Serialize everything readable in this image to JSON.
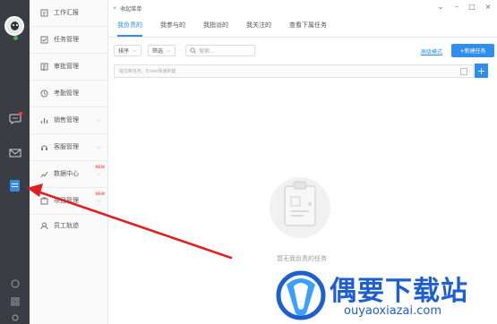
{
  "window": {
    "title": "收起菜单",
    "controls": [
      "⌄",
      "–",
      "□",
      "×"
    ]
  },
  "rail": {
    "icons": [
      "avatar",
      "chat-icon",
      "mail-icon",
      "task-icon",
      "bottom-icon-1",
      "bottom-icon-2",
      "bottom-icon-3"
    ]
  },
  "menu": {
    "items": [
      {
        "label": "工作汇报",
        "icon": "report-icon",
        "has_chevron": false
      },
      {
        "label": "任务管理",
        "icon": "task-check-icon",
        "has_chevron": false
      },
      {
        "label": "审批管理",
        "icon": "approval-icon",
        "has_chevron": false
      },
      {
        "label": "考勤管理",
        "icon": "attendance-icon",
        "has_chevron": false
      },
      {
        "label": "销售管理",
        "icon": "sales-icon",
        "has_chevron": true
      },
      {
        "label": "客服管理",
        "icon": "service-icon",
        "has_chevron": true
      },
      {
        "label": "数据中心",
        "icon": "data-icon",
        "has_chevron": true,
        "badge": "NEW"
      },
      {
        "label": "项目管理",
        "icon": "project-icon",
        "has_chevron": true,
        "badge": "NEW"
      },
      {
        "label": "员工轨迹",
        "icon": "track-icon",
        "has_chevron": false
      }
    ]
  },
  "tabs": [
    {
      "label": "我负责的",
      "active": true
    },
    {
      "label": "我参与的",
      "active": false
    },
    {
      "label": "我指派的",
      "active": false
    },
    {
      "label": "我关注的",
      "active": false
    },
    {
      "label": "查看下属任务",
      "active": false
    }
  ],
  "toolbar": {
    "sort_label": "排序",
    "filter_label": "筛选",
    "search_placeholder": "搜索...",
    "advanced_label": "高级模式",
    "new_task_label": "+新建任务"
  },
  "quick_add": {
    "placeholder": "提交新任务，Enter快速新建",
    "add_symbol": "+"
  },
  "empty_state": {
    "text": "暂无我负责的任务"
  },
  "watermark": {
    "title": "偶要下载站",
    "url": "ouyaoxiazai.com"
  },
  "colors": {
    "accent": "#2f8eed",
    "rail_bg": "#3a3d44",
    "annotation_arrow": "#e02020",
    "watermark": "#1d5fd0"
  }
}
